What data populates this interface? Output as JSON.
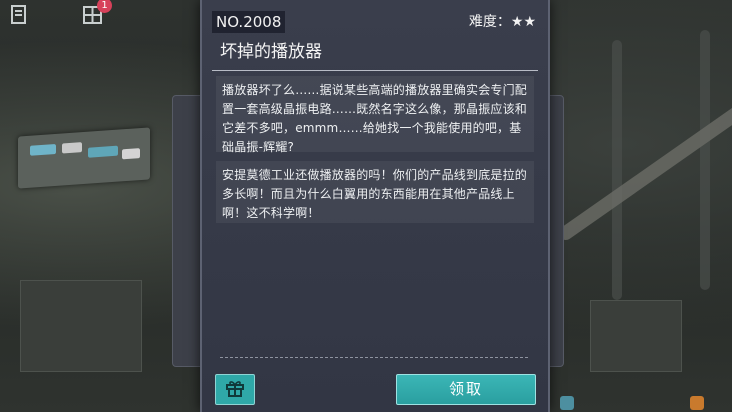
{
  "top_bar": {
    "notification_count": "1"
  },
  "quest": {
    "number": "NO.2008",
    "difficulty_label": "难度：",
    "difficulty_stars": "★★",
    "title": "坏掉的播放器",
    "paragraph_1": "播放器坏了么……据说某些高端的播放器里确实会专门配置一套高级晶振电路……既然名字这么像，那晶振应该和它差不多吧，emmm……给她找一个我能使用的吧，基础晶振-辉耀?",
    "paragraph_2": "安提莫德工业还做播放器的吗！你们的产品线到底是拉的多长啊！而且为什么白翼用的东西能用在其他产品线上啊！这不科学啊！",
    "claim_label": "领取"
  },
  "icons": {
    "top_left": "document-icon",
    "top_center": "grid-icon",
    "gift": "gift-icon"
  },
  "colors": {
    "accent": "#2fa8a8",
    "panel": "#363a48",
    "badge": "#d7415a"
  }
}
